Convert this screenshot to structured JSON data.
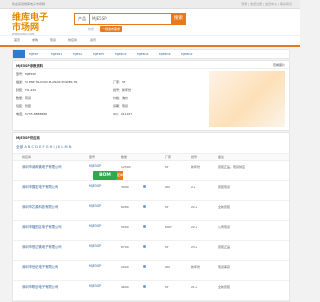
{
  "topbar": {
    "left_text": "欢迎来到维库电子市场网",
    "right_text": "登录 | 免费注册 | 会员中心 | 联系我们"
  },
  "header": {
    "logo_main": "维库电子市场网",
    "logo_sub": "WWW.DZSC.COM",
    "search_select": "产品",
    "search_value": "MJE5SP",
    "search_button": "搜索",
    "hot_label": "热搜",
    "hot_button": "一键发布需求"
  },
  "nav": {
    "items": [
      "首页",
      "求购",
      "现货",
      "供应商",
      "资讯"
    ]
  },
  "tabs": {
    "items": [
      "MJE5P",
      "MJE5B1",
      "MJE5A",
      "MJE3E5",
      "MJE8D2",
      "MJE8D4",
      "MJE8D6",
      "MJE8D2"
    ]
  },
  "info": {
    "title": "MJE5SP参数资料",
    "right_label": "查看图片",
    "rows": [
      {
        "label": "型号：",
        "value": "MJE5SP"
      },
      {
        "label": "描述：",
        "value": "SI PNP SILICON PLANAR POWER TR",
        "label2": "厂家：",
        "value2": "ST"
      },
      {
        "label": "封装：",
        "value": "TO-220",
        "label2": "批号：",
        "value2": "新年份"
      },
      {
        "label": "数量：",
        "value": "有货",
        "label2": "价格：",
        "value2": "询价"
      },
      {
        "label": "包装：",
        "value": "管装",
        "label2": "货期：",
        "value2": "现货"
      },
      {
        "label": "电话：",
        "value": "0755-8888888",
        "label2": "QQ：",
        "value2": "411107"
      }
    ]
  },
  "list": {
    "title": "MJE5SP供应商",
    "filter": "全部  A  B  C  D  E  F  G  H  I  J  K  L  M  N",
    "headers": [
      "供应商",
      "型号",
      "数量",
      "厂家",
      "批号",
      "备注"
    ],
    "bom_badge": "BOM",
    "bom_tail": "配单",
    "rows": [
      {
        "company": "深圳市诚和微电子有限公司",
        "model": "MJE5SP",
        "qty": "12500",
        "brand": "ST",
        "batch": "新年份",
        "note": "原装正品，现货供应"
      },
      {
        "company": "深圳市展宏电子有限公司",
        "model": "MJE5SP",
        "qty": "3000",
        "brand": "ON",
        "batch": "2+",
        "note": "原装现货"
      },
      {
        "company": "深圳市芯源科技有限公司",
        "model": "MJE5SP",
        "qty": "6280",
        "brand": "ST",
        "batch": "22+",
        "note": "全新原装"
      },
      {
        "company": "深圳市福田区电子有限公司",
        "model": "MJE5SP",
        "qty": "5000",
        "brand": "MOT",
        "batch": "22+",
        "note": "公司现货"
      },
      {
        "company": "深圳市恒达微电子有限公司",
        "model": "MJE5SP",
        "qty": "8700",
        "brand": "ST",
        "batch": "23+",
        "note": "原装正品"
      },
      {
        "company": "深圳市世纪电子有限公司",
        "model": "MJE5SP",
        "qty": "2000",
        "brand": "ON",
        "batch": "新年份",
        "note": "现货库存"
      },
      {
        "company": "深圳市联创电子有限公司",
        "model": "MJE5SP",
        "qty": "4600",
        "brand": "ST",
        "batch": "21+",
        "note": "全新原装"
      }
    ]
  },
  "colors": {
    "accent": "#e87a1e",
    "link": "#2a5c9a",
    "bom": "#2fa84f"
  }
}
